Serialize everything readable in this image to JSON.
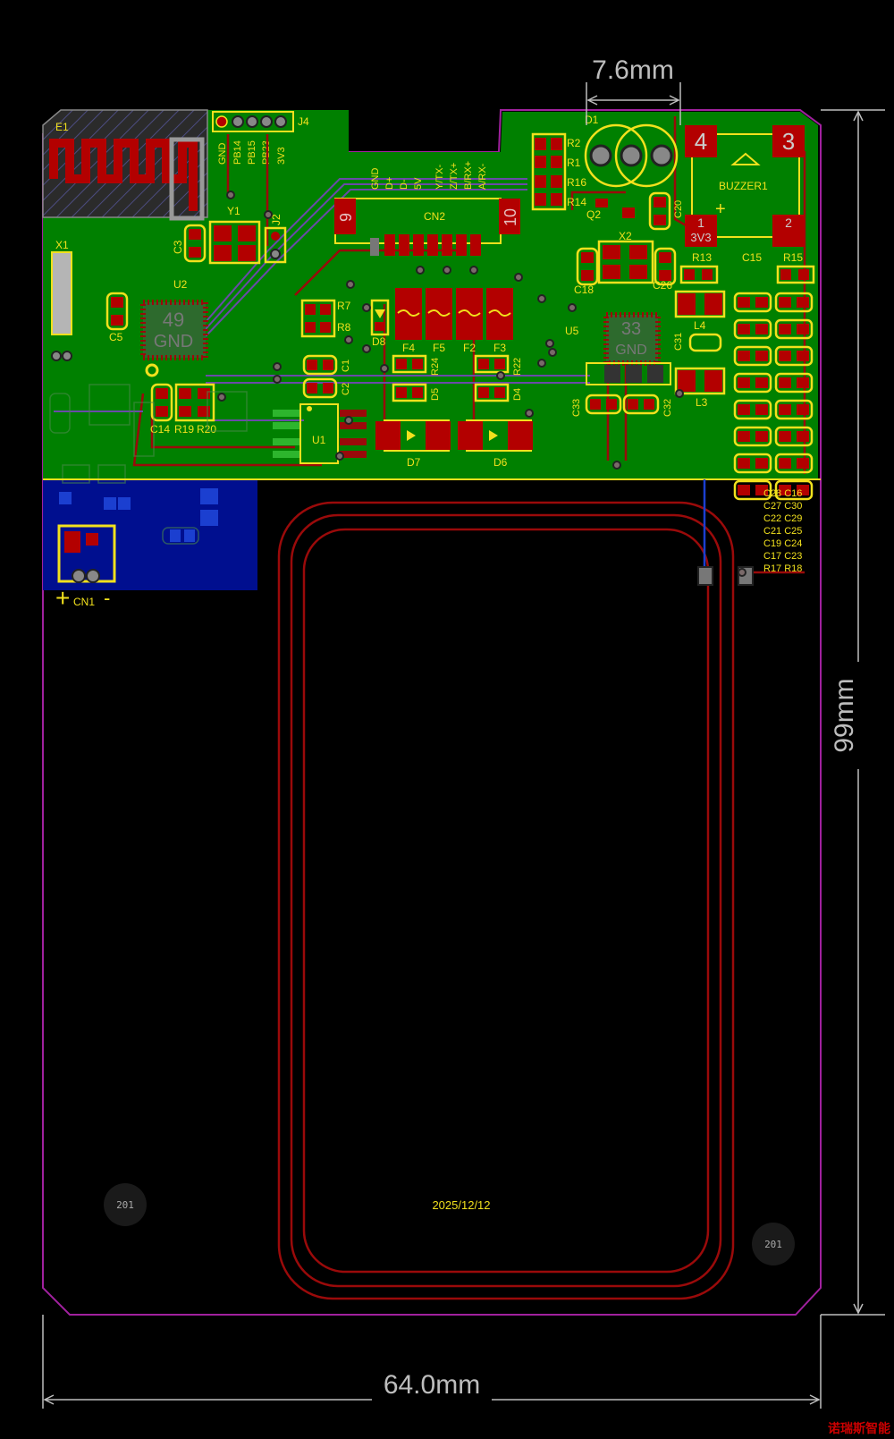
{
  "dimensions": {
    "top": "7.6mm",
    "right": "99mm",
    "bottom": "64.0mm"
  },
  "date_label": "2025/12/12",
  "badge_text": "201",
  "watermark": "诺瑞斯智能",
  "connector_j4": {
    "ref": "J4",
    "pins": [
      "GND",
      "PB14",
      "PB15",
      "PB23",
      "3V3"
    ]
  },
  "connector_cn2": {
    "ref": "CN2",
    "pin_left": "9",
    "pin_right": "10",
    "pins": [
      "GND",
      "D+",
      "D-",
      "5V",
      "Y/TX-",
      "Z/TX+",
      "B/RX+",
      "A/RX-"
    ]
  },
  "buzzer": {
    "ref": "BUZZER1",
    "pins": [
      "4",
      "3",
      "1",
      "2"
    ],
    "net": "3V3"
  },
  "chips": {
    "u2": {
      "ref": "U2",
      "center_pad": "49",
      "net": "GND"
    },
    "u5": {
      "ref": "U5",
      "center_pad": "33",
      "net": "GND"
    }
  },
  "designators": {
    "e1": "E1",
    "x1": "X1",
    "y1": "Y1",
    "j2": "J2",
    "c3": "C3",
    "c5": "C5",
    "d1": "D1",
    "q2": "Q2",
    "x2": "X2",
    "c20": "C20",
    "c18": "C18",
    "c26": "C26",
    "r13": "R13",
    "c15": "C15",
    "r15": "R15",
    "r2": "R2",
    "r1": "R1",
    "r16": "R16",
    "r14": "R14",
    "r7": "R7",
    "r8": "R8",
    "d8": "D8",
    "f4": "F4",
    "f5": "F5",
    "f2": "F2",
    "f3": "F3",
    "r24": "R24",
    "d5": "D5",
    "r22": "R22",
    "d4": "D4",
    "c1": "C1",
    "c2": "C2",
    "u1": "U1",
    "d7": "D7",
    "d6": "D6",
    "c14": "C14",
    "r19": "R19",
    "r20": "R20",
    "l4": "L4",
    "l3": "L3",
    "c31": "C31",
    "c33": "C33",
    "c32": "C32",
    "cn1": "CN1",
    "cn1_plus": "+",
    "cn1_minus": "-"
  },
  "cap_list": [
    "C28 C16",
    "C27 C30",
    "C22 C29",
    "C21 C25",
    "C19 C24",
    "C17 C23",
    "R17 R18"
  ],
  "colors": {
    "background": "#000000",
    "copper_top": "#008000",
    "copper_bottom": "#000f8f",
    "pads": "#b30000",
    "silkscreen": "#f2e11d",
    "outline": "#a0219e",
    "dimension": "#bdbdbd"
  }
}
